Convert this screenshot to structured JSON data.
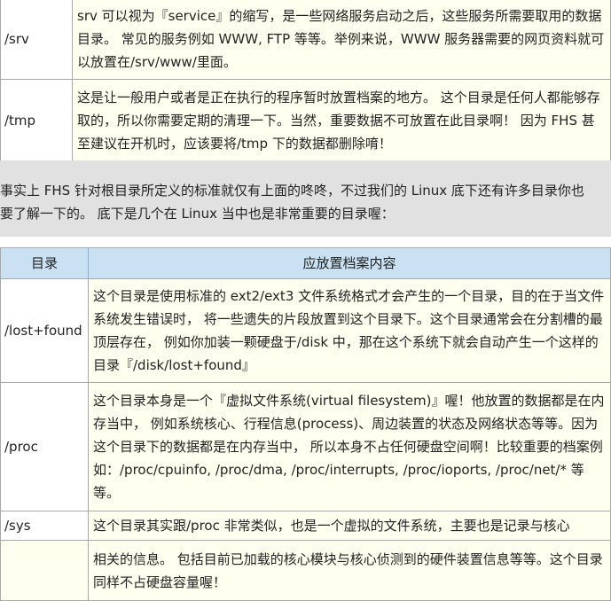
{
  "table1": {
    "rows": [
      {
        "name": "/srv",
        "desc": "srv 可以视为『service』的缩写，是一些网络服务启动之后，这些服务所需要取用的数据目录。 常见的服务例如 WWW, FTP 等等。举例来说，WWW 服务器需要的网页资料就可以放置在/srv/www/里面。"
      },
      {
        "name": "/tmp",
        "desc": "这是让一般用户或者是正在执行的程序暂时放置档案的地方。 这个目录是任何人都能够存取的，所以你需要定期的清理一下。当然，重要数据不可放置在此目录啊！ 因为 FHS 甚至建议在开机时，应该要将/tmp 下的数据都删除唷！"
      }
    ]
  },
  "paragraph": {
    "line1": "事实上 FHS 针对根目录所定义的标准就仅有上面的咚咚，不过我们的 Linux 底下还有许多目录你也",
    "line2": "要了解一下的。 底下是几个在 Linux 当中也是非常重要的目录喔："
  },
  "table2": {
    "header": {
      "col1": "目录",
      "col2": "应放置档案内容"
    },
    "rows": [
      {
        "name": "/lost+found",
        "desc": "这个目录是使用标准的 ext2/ext3 文件系统格式才会产生的一个目录，目的在于当文件系统发生错误时， 将一些遗失的片段放置到这个目录下。这个目录通常会在分割槽的最顶层存在， 例如你加装一颗硬盘于/disk 中，那在这个系统下就会自动产生一个这样的目录『/disk/lost+found』"
      },
      {
        "name": "/proc",
        "desc": "这个目录本身是一个『虚拟文件系统(virtual filesystem)』喔！他放置的数据都是在内存当中， 例如系统核心、行程信息(process)、周边装置的状态及网络状态等等。因为这个目录下的数据都是在内存当中， 所以本身不占任何硬盘空间啊！比较重要的档案例如：/proc/cpuinfo, /proc/dma, /proc/interrupts, /proc/ioports, /proc/net/* 等等。"
      },
      {
        "name": "/sys",
        "desc": "这个目录其实跟/proc 非常类似，也是一个虚拟的文件系统，主要也是记录与核心"
      }
    ],
    "continuation": "相关的信息。 包括目前已加载的核心模块与核心侦测到的硬件装置信息等等。这个目录同样不占硬盘容量喔！"
  }
}
